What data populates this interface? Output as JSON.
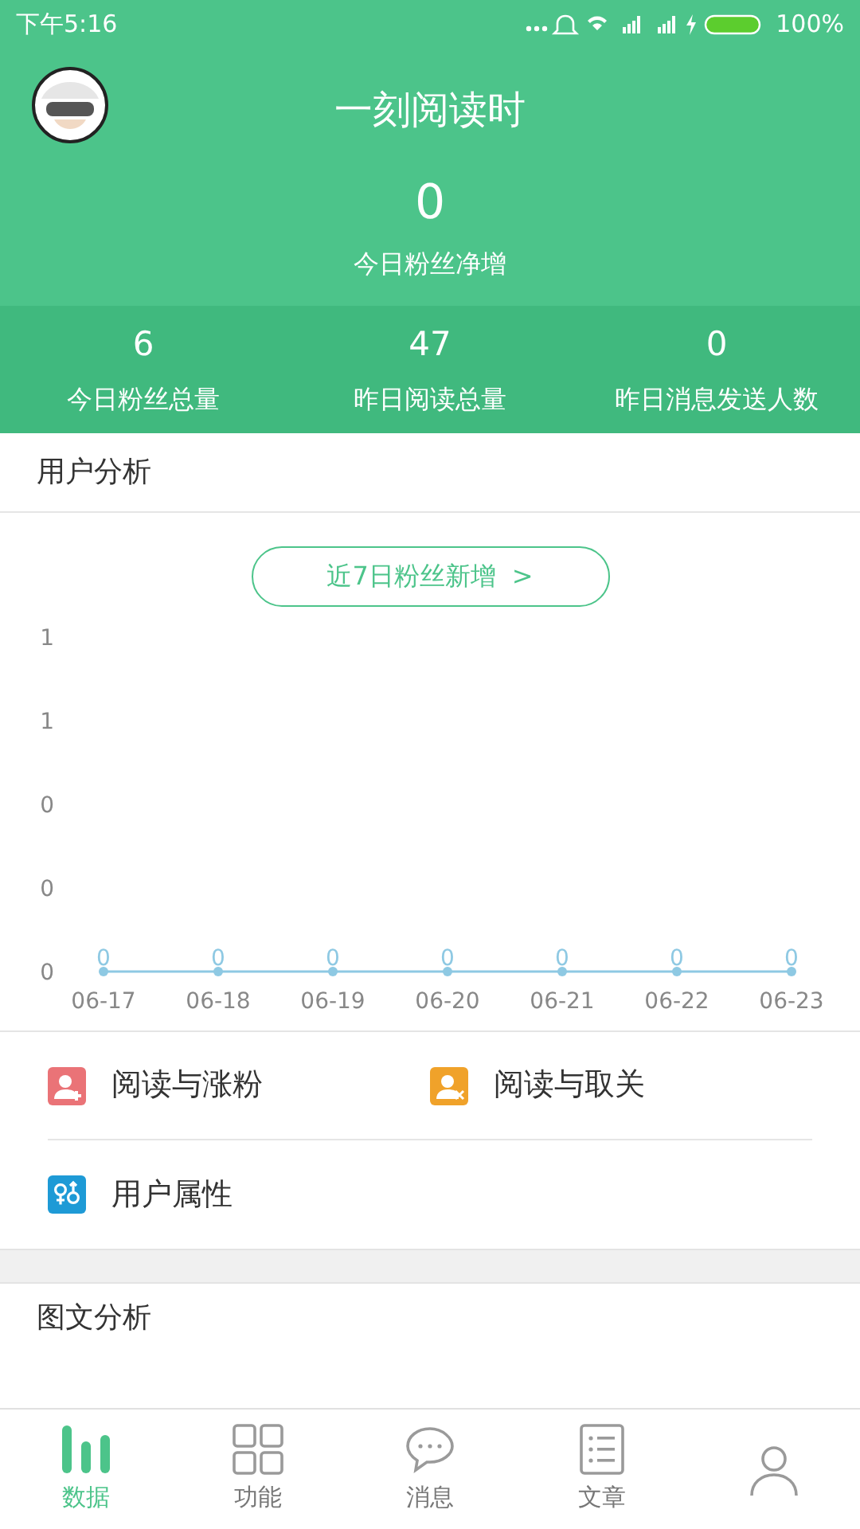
{
  "status_bar": {
    "time": "下午5:16",
    "battery": "100%"
  },
  "header": {
    "title": "一刻阅读时",
    "today_net": "0",
    "today_net_label": "今日粉丝净增"
  },
  "stats": [
    {
      "value": "6",
      "label": "今日粉丝总量"
    },
    {
      "value": "47",
      "label": "昨日阅读总量"
    },
    {
      "value": "0",
      "label": "昨日消息发送人数"
    }
  ],
  "user_analysis": {
    "title": "用户分析",
    "range_button": "近7日粉丝新增",
    "range_arrow": ">",
    "chart_data": {
      "type": "line",
      "categories": [
        "06-17",
        "06-18",
        "06-19",
        "06-20",
        "06-21",
        "06-22",
        "06-23"
      ],
      "series": [
        {
          "color": "#8ec9e3",
          "marker": "o",
          "values": [
            0,
            0,
            0,
            0,
            0,
            0,
            0
          ]
        }
      ],
      "ylim": [
        0,
        1
      ],
      "yticks": [
        {
          "value": 0,
          "label": "0"
        },
        {
          "value": 0.25,
          "label": "0"
        },
        {
          "value": 0.5,
          "label": "0"
        },
        {
          "value": 0.75,
          "label": "1"
        },
        {
          "value": 1,
          "label": "1"
        }
      ],
      "data_labels": true
    },
    "links": [
      {
        "kind": "follow",
        "label": "阅读与涨粉",
        "color": "#ea7377"
      },
      {
        "kind": "unfollow",
        "label": "阅读与取关",
        "color": "#f0a22a"
      },
      {
        "kind": "gender",
        "label": "用户属性",
        "color": "#1e9ad6"
      }
    ]
  },
  "article_analysis": {
    "title": "图文分析"
  },
  "tabs": [
    {
      "kind": "data",
      "label": "数据",
      "selected": true
    },
    {
      "kind": "grid",
      "label": "功能",
      "selected": false
    },
    {
      "kind": "chat",
      "label": "消息",
      "selected": false
    },
    {
      "kind": "doc",
      "label": "文章",
      "selected": false
    },
    {
      "kind": "person",
      "selected": false
    }
  ]
}
